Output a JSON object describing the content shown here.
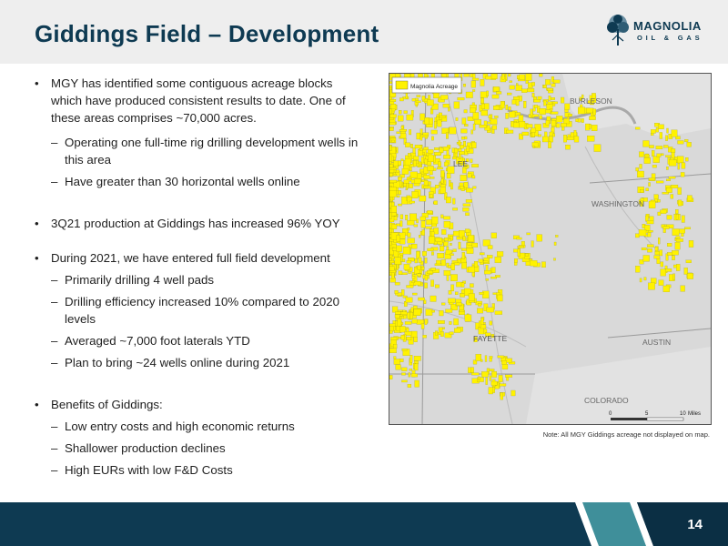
{
  "header": {
    "title": "Giddings Field – Development",
    "logo": {
      "word": "MAGNOLIA",
      "sub": "OIL & GAS"
    }
  },
  "bullets": [
    {
      "level": 1,
      "text": "MGY has identified some contiguous acreage blocks which have produced consistent results to date. One of these areas comprises ~70,000 acres."
    },
    {
      "level": 2,
      "text": "Operating one full-time rig drilling development wells in this area"
    },
    {
      "level": 2,
      "text": "Have greater than 30 horizontal wells online"
    },
    {
      "level": 1,
      "text": "3Q21 production at Giddings has increased 96% YOY"
    },
    {
      "level": 1,
      "text": "During 2021, we have entered full field development"
    },
    {
      "level": 2,
      "text": "Primarily drilling 4 well pads"
    },
    {
      "level": 2,
      "text": "Drilling efficiency increased 10% compared to 2020 levels"
    },
    {
      "level": 2,
      "text": "Averaged ~7,000 foot laterals YTD"
    },
    {
      "level": 2,
      "text": "Plan to bring ~24 wells online during 2021"
    },
    {
      "level": 1,
      "text": "Benefits of Giddings:"
    },
    {
      "level": 2,
      "text": "Low entry costs and high economic returns"
    },
    {
      "level": 2,
      "text": "Shallower production declines"
    },
    {
      "level": 2,
      "text": "High EURs with low F&D Costs"
    }
  ],
  "map": {
    "legend_label": "Magnolia Acreage",
    "acreage_color": "#fff200",
    "county_labels": [
      "BURLESON",
      "LEE",
      "WASHINGTON",
      "FAYETTE",
      "AUSTIN",
      "COLORADO"
    ],
    "scale": {
      "ticks": [
        "0",
        "5",
        "10"
      ],
      "unit": "Miles"
    },
    "note": "Note: All MGY Giddings acreage not displayed on map."
  },
  "footer": {
    "page_number": "14"
  }
}
